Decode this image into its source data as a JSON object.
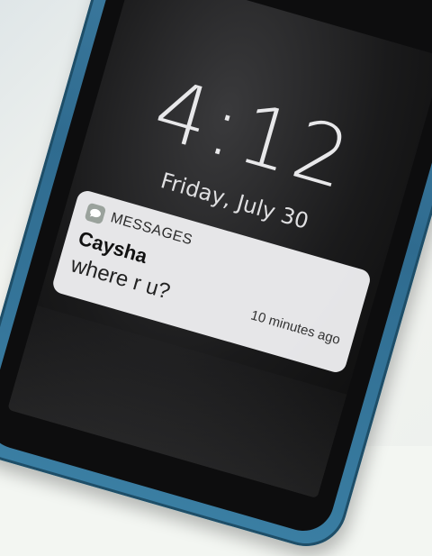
{
  "lock_screen": {
    "time": "4:12",
    "date": "Friday, July 30"
  },
  "notification": {
    "app_name": "MESSAGES",
    "app_icon": "messages-icon",
    "sender": "Caysha",
    "message": "where r u?",
    "time_ago": "10 minutes ago"
  },
  "colors": {
    "phone_case": "#3a7ea3",
    "screen": "#1a1a1b",
    "notification_bg": "#eeeef0"
  }
}
